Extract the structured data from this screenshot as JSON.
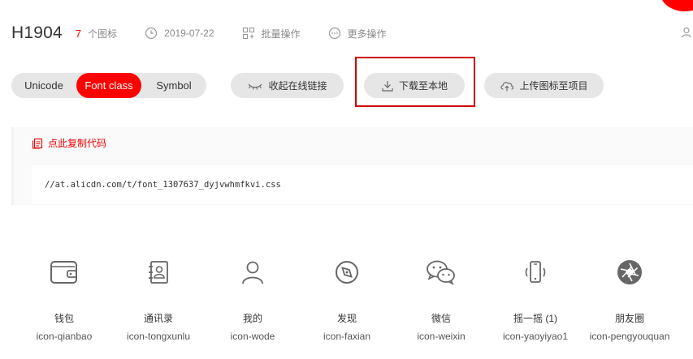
{
  "header": {
    "title": "H1904",
    "count": "7",
    "count_label": "个图标",
    "date": "2019-07-22",
    "batch_label": "批量操作",
    "more_label": "更多操作"
  },
  "tabs": [
    {
      "label": "Unicode",
      "active": false
    },
    {
      "label": "Font class",
      "active": true
    },
    {
      "label": "Symbol",
      "active": false
    }
  ],
  "toolbar": {
    "collapse_label": "收起在线链接",
    "download_label": "下载至本地",
    "upload_label": "上传图标至项目"
  },
  "code": {
    "copy_label": "点此复制代码",
    "url": "//at.alicdn.com/t/font_1307637_dyjvwhmfkvi.css"
  },
  "icons": [
    {
      "cn": "钱包",
      "en": "icon-qianbao",
      "icon": "wallet-icon"
    },
    {
      "cn": "通讯录",
      "en": "icon-tongxunlu",
      "icon": "contacts-icon"
    },
    {
      "cn": "我的",
      "en": "icon-wode",
      "icon": "user-icon"
    },
    {
      "cn": "发现",
      "en": "icon-faxian",
      "icon": "compass-icon"
    },
    {
      "cn": "微信",
      "en": "icon-weixin",
      "icon": "wechat-icon"
    },
    {
      "cn": "摇一摇 (1)",
      "en": "icon-yaoyiyao1",
      "icon": "shake-phone-icon"
    },
    {
      "cn": "朋友圈",
      "en": "icon-pengyouquan",
      "icon": "aperture-icon"
    }
  ],
  "colors": {
    "accent": "#ff0000",
    "highlight_border": "#cc0000",
    "pill_bg": "#e6e6e6"
  }
}
